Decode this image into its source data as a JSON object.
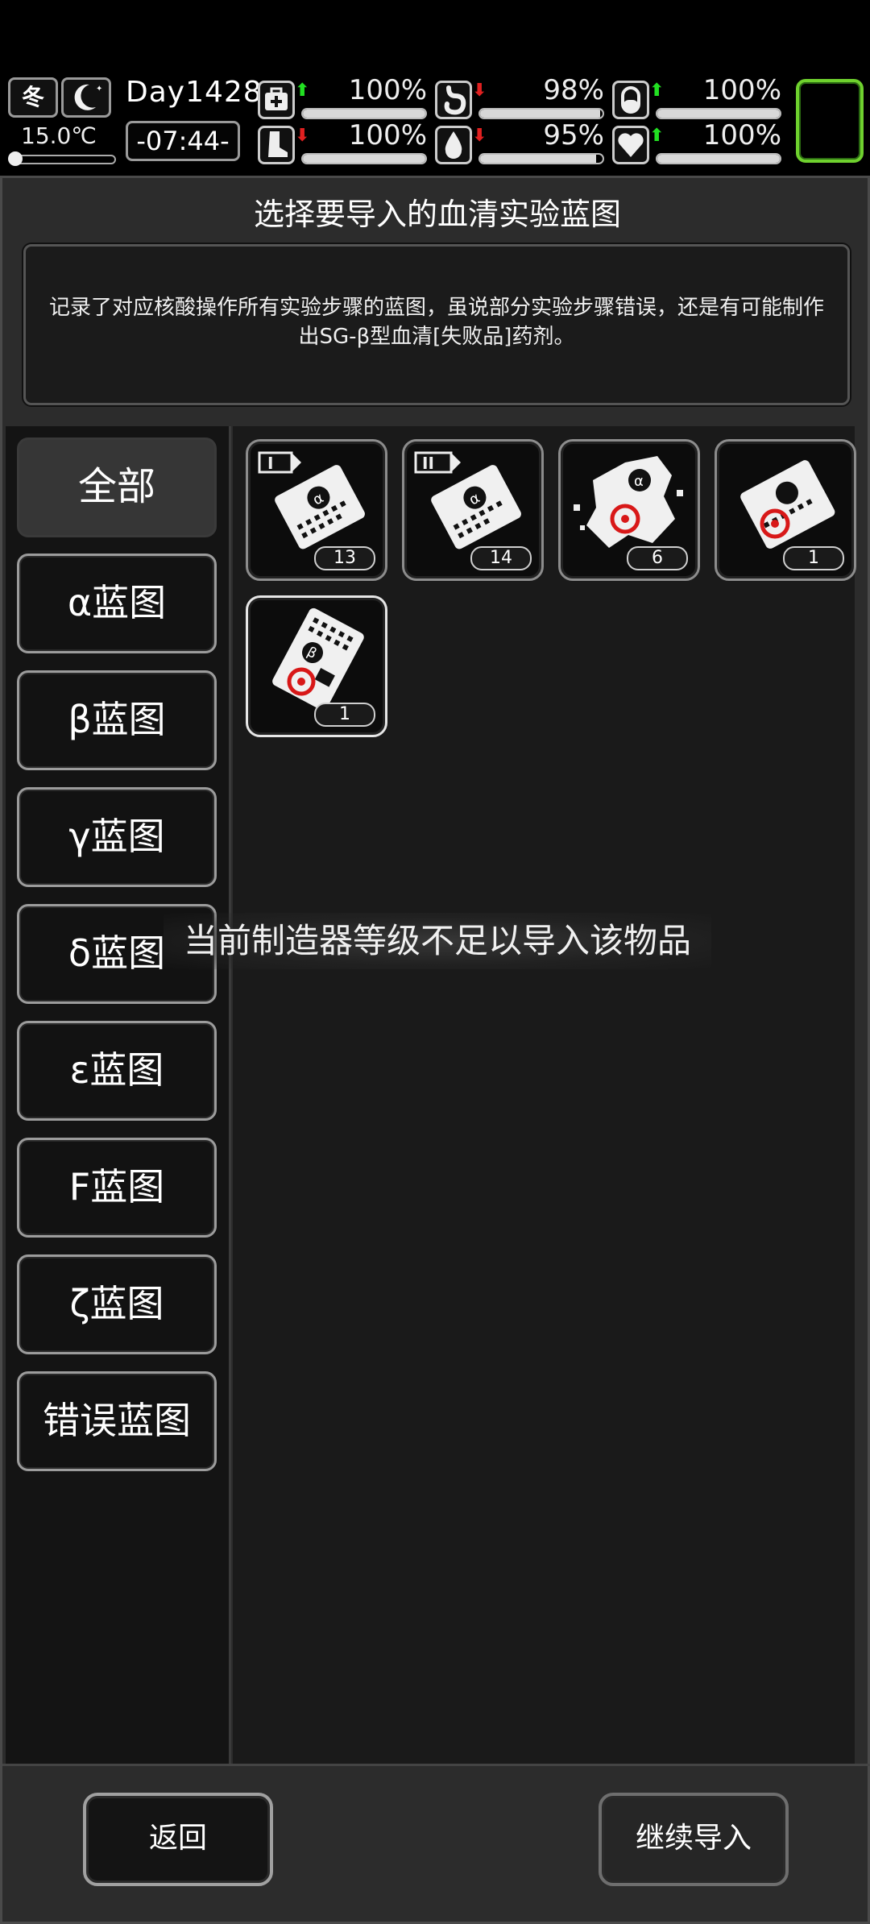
{
  "hud": {
    "season": "冬",
    "temperature": "15.0℃",
    "day": "Day1428",
    "time": "-07:44-",
    "stats": [
      {
        "name": "health",
        "icon": "medkit-icon",
        "trend": "up",
        "value": "100%",
        "level": 1.0
      },
      {
        "name": "hunger",
        "icon": "stomach-icon",
        "trend": "down",
        "value": "98%",
        "level": 0.98
      },
      {
        "name": "medicine",
        "icon": "pill-icon",
        "trend": "up",
        "value": "100%",
        "level": 1.0
      },
      {
        "name": "stamina",
        "icon": "foot-icon",
        "trend": "down",
        "value": "100%",
        "level": 1.0
      },
      {
        "name": "thirst",
        "icon": "water-drop-icon",
        "trend": "down",
        "value": "95%",
        "level": 0.95
      },
      {
        "name": "mood",
        "icon": "heart-icon",
        "trend": "up",
        "value": "100%",
        "level": 1.0
      }
    ],
    "colors": {
      "up": "#22e022",
      "down": "#e02020",
      "slot": "#6fd12e"
    }
  },
  "panel": {
    "title": "选择要导入的血清实验蓝图",
    "description": "记录了对应核酸操作所有实验步骤的蓝图，虽说部分实验步骤错误，还是有可能制作出SG-β型血清[失败品]药剂。"
  },
  "tabs": [
    "全部",
    "α蓝图",
    "β蓝图",
    "γ蓝图",
    "δ蓝图",
    "ε蓝图",
    "Ϝ蓝图",
    "ζ蓝图",
    "错误蓝图"
  ],
  "active_tab": 0,
  "items": [
    {
      "icon": "alpha-blueprint-scroll-i-icon",
      "tag": "I",
      "symbol": "α",
      "count": "13"
    },
    {
      "icon": "alpha-blueprint-scroll-ii-icon",
      "tag": "II",
      "symbol": "α",
      "count": "14"
    },
    {
      "icon": "torn-alpha-blueprint-biohazard-icon",
      "tag": "",
      "symbol": "α",
      "count": "6"
    },
    {
      "icon": "blueprint-scroll-biohazard-icon",
      "tag": "",
      "symbol": "",
      "count": "1"
    },
    {
      "icon": "beta-blueprint-biohazard-icon",
      "tag": "",
      "symbol": "β",
      "count": "1"
    }
  ],
  "toast": "当前制造器等级不足以导入该物品",
  "buttons": {
    "back": "返回",
    "continue": "继续导入"
  }
}
